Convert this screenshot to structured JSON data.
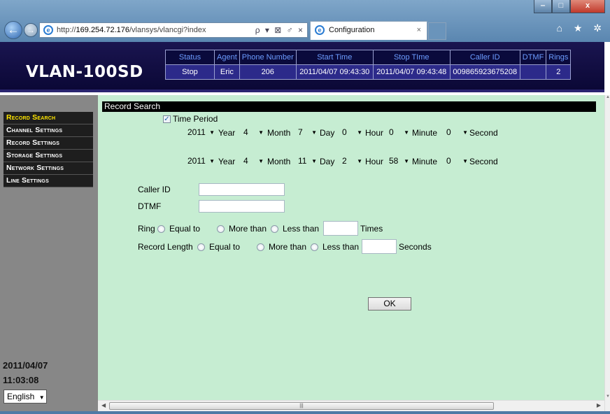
{
  "browser": {
    "url_prefix": "http://",
    "url_host": "169.254.72.176",
    "url_path": "/vlansys/vlancgi?index",
    "address_tools": "ρ ▾ ⊠ ♂ ×",
    "tab_title": "Configuration",
    "tab_close": "×",
    "toolbar_icons": "⌂ ★ ✲",
    "win_min": "‒",
    "win_max": "□",
    "win_close": "x"
  },
  "header": {
    "logo": "VLAN-100SD",
    "status_headers": [
      "Status",
      "Agent",
      "Phone Number",
      "Start Time",
      "Stop TIme",
      "Caller ID",
      "DTMF",
      "Rings"
    ],
    "status_values": [
      "Stop",
      "Eric",
      "206",
      "2011/04/07 09:43:30",
      "2011/04/07 09:43:48",
      "009865923675208",
      "",
      "2"
    ]
  },
  "sidebar": {
    "items": [
      {
        "label": "Record Search",
        "active": true
      },
      {
        "label": "Channel Settings",
        "active": false
      },
      {
        "label": "Record Settings",
        "active": false
      },
      {
        "label": "Storage Settings",
        "active": false
      },
      {
        "label": "Network Settings",
        "active": false
      },
      {
        "label": "Line Settings",
        "active": false
      }
    ],
    "date": "2011/04/07",
    "time": "11:03:08",
    "language": "English"
  },
  "search": {
    "title": "Record Search",
    "time_period_label": "Time Period",
    "time_period_checked": true,
    "start": {
      "year": "2011",
      "month": "4",
      "day": "7",
      "hour": "0",
      "minute": "0",
      "second": "0"
    },
    "end": {
      "year": "2011",
      "month": "4",
      "day": "11",
      "hour": "2",
      "minute": "58",
      "second": "0"
    },
    "units": {
      "year": "Year",
      "month": "Month",
      "day": "Day",
      "hour": "Hour",
      "minute": "Minute",
      "second": "Second"
    },
    "caller_id_label": "Caller ID",
    "caller_id_value": "",
    "dtmf_label": "DTMF",
    "dtmf_value": "",
    "ring_label": "Ring",
    "record_length_label": "Record Length",
    "equal_to": "Equal to",
    "more_than": "More than",
    "less_than": "Less than",
    "times_label": "Times",
    "seconds_label": "Seconds",
    "ring_value": "",
    "length_value": "",
    "ok_label": "OK"
  },
  "icons": {
    "back": "back-arrow-icon",
    "forward": "forward-arrow-icon",
    "ie": "ie-logo-icon",
    "dropdown": "chevron-down-icon"
  },
  "colors": {
    "header_bg": "#0b0836",
    "sidebar_bg": "#878787",
    "content_bg": "#c6edd2",
    "active_menu": "#ffe600",
    "status_header_text": "#6c9cff"
  }
}
